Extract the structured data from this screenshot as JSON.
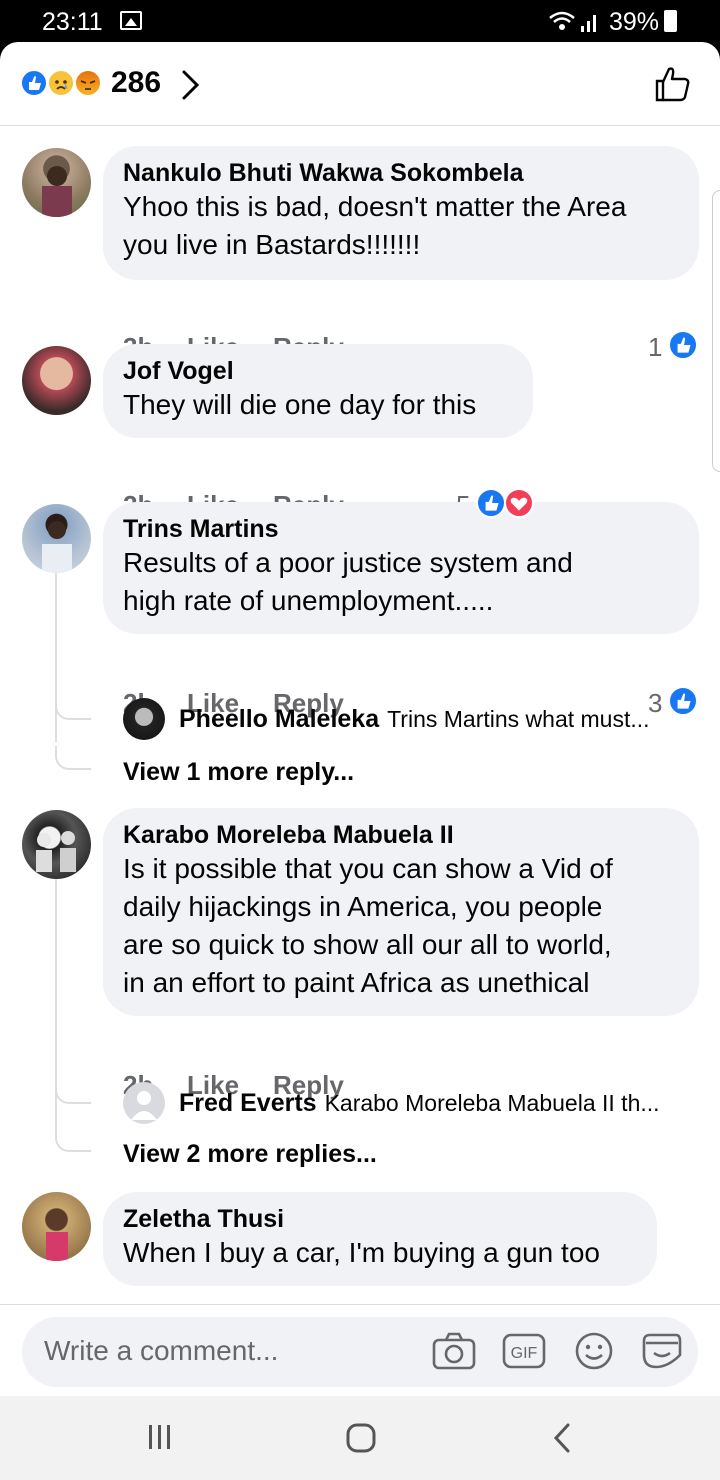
{
  "status_bar": {
    "time": "23:11",
    "battery": "39%"
  },
  "reactions_header": {
    "count": "286",
    "emojis": [
      "like-icon",
      "sad-icon",
      "angry-icon"
    ]
  },
  "comments": [
    {
      "author": "Nankulo Bhuti Wakwa Sokombela",
      "text_lines": [
        "Yhoo this is bad, doesn't matter the Area",
        "you live in Bastards!!!!!!!"
      ],
      "time": "3h",
      "like_label": "Like",
      "reply_label": "Reply",
      "reaction_count": "1"
    },
    {
      "author": "Jof Vogel",
      "text_lines": [
        "They will die one day for this"
      ],
      "time": "2h",
      "like_label": "Like",
      "reply_label": "Reply",
      "reaction_count": "5"
    },
    {
      "author": "Trins Martins",
      "text_lines": [
        "Results of a poor justice system and",
        "high rate of unemployment....."
      ],
      "time": "2h",
      "like_label": "Like",
      "reply_label": "Reply",
      "reaction_count": "3",
      "reply_preview": {
        "author": "Pheello Maleleka",
        "text": "Trins Martins what must..."
      },
      "view_more": "View 1 more reply..."
    },
    {
      "author": "Karabo Moreleba Mabuela II",
      "text_lines": [
        "Is it possible that you can show a Vid of",
        "daily hijackings in America, you people",
        "are so quick to show all our all to world,",
        "in an effort to paint Africa as unethical"
      ],
      "time": "2h",
      "like_label": "Like",
      "reply_label": "Reply",
      "reply_preview": {
        "author": "Fred Everts",
        "text": "Karabo Moreleba Mabuela II  th..."
      },
      "view_more": "View 2 more replies..."
    },
    {
      "author": "Zeletha Thusi",
      "text_lines": [
        "When I buy a car, I'm buying a gun too"
      ]
    }
  ],
  "composer": {
    "placeholder": "Write a comment...",
    "icons": [
      "camera-icon",
      "gif-icon",
      "emoji-icon",
      "sticker-icon"
    ]
  },
  "colors": {
    "like_blue": "#1877f2",
    "love_red": "#f33e58",
    "bubble_bg": "#f0f2f5",
    "meta_gray": "#65676b"
  }
}
